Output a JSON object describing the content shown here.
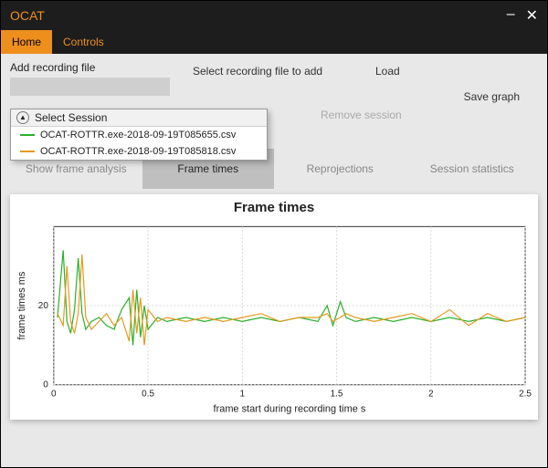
{
  "app": {
    "title": "OCAT"
  },
  "tabs": {
    "active": "Home",
    "items": [
      "Home",
      "Controls"
    ]
  },
  "upper": {
    "add_label": "Add recording file",
    "select_label": "Select recording file to add",
    "load_label": "Load",
    "save_label": "Save graph",
    "remove_label": "Remove session",
    "session_dropdown": {
      "header": "Select Session",
      "items": [
        {
          "file": "OCAT-ROTTR.exe-2018-09-19T085655.csv",
          "color": "#2bb02b"
        },
        {
          "file": "OCAT-ROTTR.exe-2018-09-19T085818.csv",
          "color": "#e69a1f"
        }
      ]
    }
  },
  "views": {
    "active": 1,
    "items": [
      "Show frame analysis",
      "Frame times",
      "Reprojections",
      "Session statistics"
    ]
  },
  "chart_data": {
    "type": "line",
    "title": "Frame times",
    "xlabel": "frame start during recording time s",
    "ylabel": "frame times ms",
    "xlim": [
      0,
      2.5
    ],
    "ylim": [
      0,
      40
    ],
    "xticks": [
      0,
      0.5,
      1,
      1.5,
      2,
      2.5
    ],
    "yticks": [
      0,
      20
    ],
    "series": [
      {
        "name": "OCAT-ROTTR.exe-2018-09-19T085655.csv",
        "color": "#2bb02b",
        "points": [
          [
            0.02,
            17
          ],
          [
            0.05,
            34
          ],
          [
            0.07,
            16
          ],
          [
            0.09,
            13
          ],
          [
            0.11,
            19
          ],
          [
            0.13,
            32
          ],
          [
            0.15,
            18
          ],
          [
            0.17,
            14
          ],
          [
            0.2,
            16
          ],
          [
            0.24,
            17
          ],
          [
            0.28,
            15
          ],
          [
            0.32,
            14
          ],
          [
            0.36,
            19
          ],
          [
            0.4,
            22
          ],
          [
            0.42,
            10
          ],
          [
            0.44,
            24
          ],
          [
            0.46,
            12
          ],
          [
            0.48,
            20
          ],
          [
            0.5,
            14
          ],
          [
            0.55,
            17
          ],
          [
            0.6,
            16
          ],
          [
            0.7,
            17
          ],
          [
            0.8,
            16
          ],
          [
            0.9,
            17
          ],
          [
            1.0,
            16
          ],
          [
            1.1,
            17
          ],
          [
            1.2,
            16
          ],
          [
            1.3,
            17
          ],
          [
            1.4,
            16
          ],
          [
            1.45,
            20
          ],
          [
            1.48,
            15
          ],
          [
            1.52,
            21
          ],
          [
            1.55,
            17
          ],
          [
            1.6,
            16
          ],
          [
            1.7,
            17
          ],
          [
            1.8,
            16
          ],
          [
            1.9,
            17
          ],
          [
            2.0,
            16
          ],
          [
            2.1,
            17
          ],
          [
            2.2,
            16
          ],
          [
            2.3,
            17
          ],
          [
            2.4,
            16
          ],
          [
            2.5,
            17
          ]
        ]
      },
      {
        "name": "OCAT-ROTTR.exe-2018-09-19T085818.csv",
        "color": "#e69a1f",
        "points": [
          [
            0.02,
            18
          ],
          [
            0.05,
            15
          ],
          [
            0.07,
            30
          ],
          [
            0.09,
            16
          ],
          [
            0.11,
            13
          ],
          [
            0.13,
            18
          ],
          [
            0.15,
            33
          ],
          [
            0.17,
            17
          ],
          [
            0.2,
            14
          ],
          [
            0.24,
            16
          ],
          [
            0.28,
            18
          ],
          [
            0.32,
            15
          ],
          [
            0.36,
            17
          ],
          [
            0.4,
            11
          ],
          [
            0.42,
            24
          ],
          [
            0.44,
            13
          ],
          [
            0.46,
            22
          ],
          [
            0.48,
            10
          ],
          [
            0.5,
            19
          ],
          [
            0.55,
            16
          ],
          [
            0.6,
            17
          ],
          [
            0.7,
            16
          ],
          [
            0.8,
            17
          ],
          [
            0.9,
            16
          ],
          [
            1.0,
            17
          ],
          [
            1.1,
            18
          ],
          [
            1.2,
            16
          ],
          [
            1.3,
            17
          ],
          [
            1.4,
            17
          ],
          [
            1.45,
            18
          ],
          [
            1.48,
            16
          ],
          [
            1.52,
            17
          ],
          [
            1.55,
            18
          ],
          [
            1.6,
            17
          ],
          [
            1.7,
            16
          ],
          [
            1.8,
            17
          ],
          [
            1.9,
            18
          ],
          [
            2.0,
            16
          ],
          [
            2.1,
            19
          ],
          [
            2.2,
            15
          ],
          [
            2.3,
            18
          ],
          [
            2.4,
            16
          ],
          [
            2.5,
            17
          ]
        ]
      }
    ]
  }
}
